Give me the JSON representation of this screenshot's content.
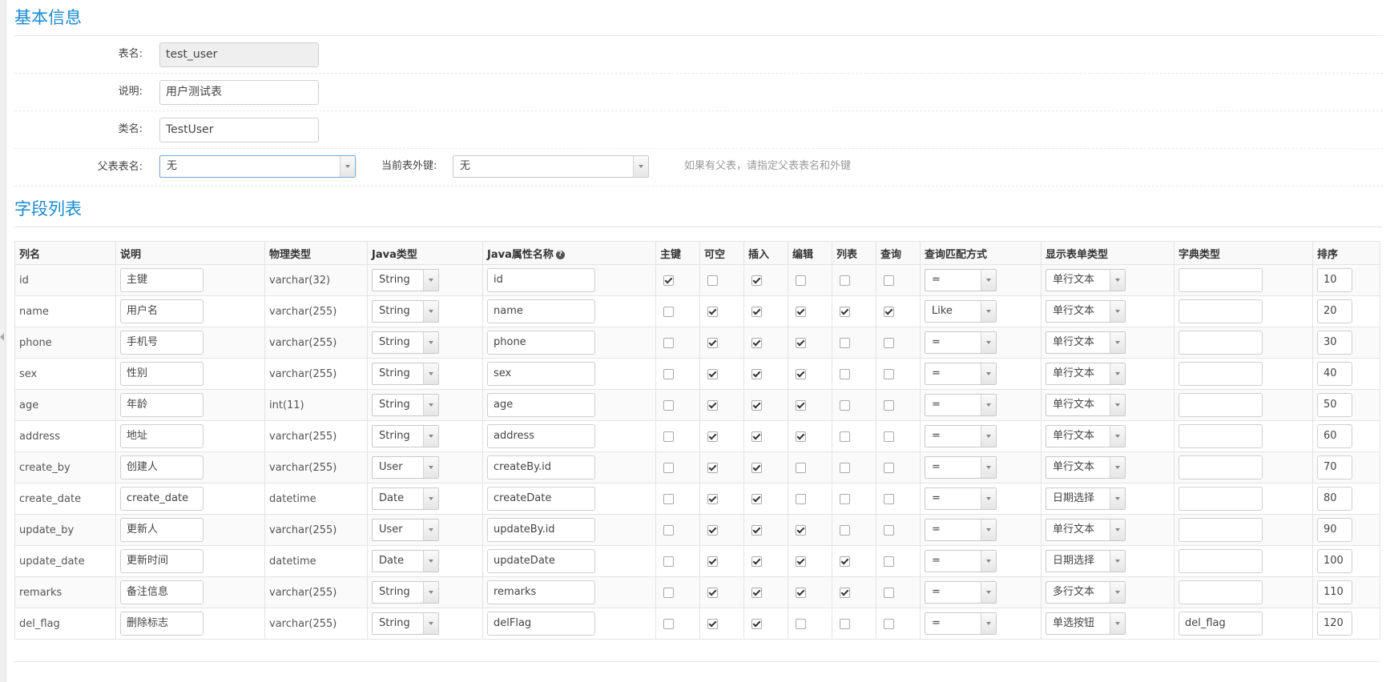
{
  "basic": {
    "title": "基本信息",
    "table_name_label": "表名:",
    "table_name_value": "test_user",
    "comment_label": "说明:",
    "comment_value": "用户测试表",
    "class_name_label": "类名:",
    "class_name_value": "TestUser",
    "parent_table_label": "父表表名:",
    "parent_table_value": "无",
    "foreign_key_label": "当前表外键:",
    "foreign_key_value": "无",
    "hint": "如果有父表，请指定父表表名和外键"
  },
  "fields": {
    "title": "字段列表",
    "headers": [
      "列名",
      "说明",
      "物理类型",
      "Java类型",
      "Java属性名称",
      "主键",
      "可空",
      "插入",
      "编辑",
      "列表",
      "查询",
      "查询匹配方式",
      "显示表单类型",
      "字典类型",
      "排序"
    ],
    "rows": [
      {
        "col": "id",
        "comment": "主键",
        "jdbc": "varchar(32)",
        "java": "String",
        "prop": "id",
        "pk": true,
        "nullable": false,
        "insert": true,
        "edit": false,
        "list": false,
        "query": false,
        "match": "=",
        "form": "单行文本",
        "dict": "",
        "sort": "10"
      },
      {
        "col": "name",
        "comment": "用户名",
        "jdbc": "varchar(255)",
        "java": "String",
        "prop": "name",
        "pk": false,
        "nullable": true,
        "insert": true,
        "edit": true,
        "list": true,
        "query": true,
        "match": "Like",
        "form": "单行文本",
        "dict": "",
        "sort": "20"
      },
      {
        "col": "phone",
        "comment": "手机号",
        "jdbc": "varchar(255)",
        "java": "String",
        "prop": "phone",
        "pk": false,
        "nullable": true,
        "insert": true,
        "edit": true,
        "list": false,
        "query": false,
        "match": "=",
        "form": "单行文本",
        "dict": "",
        "sort": "30"
      },
      {
        "col": "sex",
        "comment": "性别",
        "jdbc": "varchar(255)",
        "java": "String",
        "prop": "sex",
        "pk": false,
        "nullable": true,
        "insert": true,
        "edit": true,
        "list": false,
        "query": false,
        "match": "=",
        "form": "单行文本",
        "dict": "",
        "sort": "40"
      },
      {
        "col": "age",
        "comment": "年龄",
        "jdbc": "int(11)",
        "java": "String",
        "prop": "age",
        "pk": false,
        "nullable": true,
        "insert": true,
        "edit": true,
        "list": false,
        "query": false,
        "match": "=",
        "form": "单行文本",
        "dict": "",
        "sort": "50"
      },
      {
        "col": "address",
        "comment": "地址",
        "jdbc": "varchar(255)",
        "java": "String",
        "prop": "address",
        "pk": false,
        "nullable": true,
        "insert": true,
        "edit": true,
        "list": false,
        "query": false,
        "match": "=",
        "form": "单行文本",
        "dict": "",
        "sort": "60"
      },
      {
        "col": "create_by",
        "comment": "创建人",
        "jdbc": "varchar(255)",
        "java": "User",
        "prop": "createBy.id",
        "pk": false,
        "nullable": true,
        "insert": true,
        "edit": false,
        "list": false,
        "query": false,
        "match": "=",
        "form": "单行文本",
        "dict": "",
        "sort": "70"
      },
      {
        "col": "create_date",
        "comment": "create_date",
        "jdbc": "datetime",
        "java": "Date",
        "prop": "createDate",
        "pk": false,
        "nullable": true,
        "insert": true,
        "edit": false,
        "list": false,
        "query": false,
        "match": "=",
        "form": "日期选择",
        "dict": "",
        "sort": "80"
      },
      {
        "col": "update_by",
        "comment": "更新人",
        "jdbc": "varchar(255)",
        "java": "User",
        "prop": "updateBy.id",
        "pk": false,
        "nullable": true,
        "insert": true,
        "edit": true,
        "list": false,
        "query": false,
        "match": "=",
        "form": "单行文本",
        "dict": "",
        "sort": "90"
      },
      {
        "col": "update_date",
        "comment": "更新时间",
        "jdbc": "datetime",
        "java": "Date",
        "prop": "updateDate",
        "pk": false,
        "nullable": true,
        "insert": true,
        "edit": true,
        "list": true,
        "query": false,
        "match": "=",
        "form": "日期选择",
        "dict": "",
        "sort": "100"
      },
      {
        "col": "remarks",
        "comment": "备注信息",
        "jdbc": "varchar(255)",
        "java": "String",
        "prop": "remarks",
        "pk": false,
        "nullable": true,
        "insert": true,
        "edit": true,
        "list": true,
        "query": false,
        "match": "=",
        "form": "多行文本",
        "dict": "",
        "sort": "110"
      },
      {
        "col": "del_flag",
        "comment": "删除标志",
        "jdbc": "varchar(255)",
        "java": "String",
        "prop": "delFlag",
        "pk": false,
        "nullable": true,
        "insert": true,
        "edit": false,
        "list": false,
        "query": false,
        "match": "=",
        "form": "单选按钮",
        "dict": "del_flag",
        "sort": "120"
      }
    ]
  }
}
